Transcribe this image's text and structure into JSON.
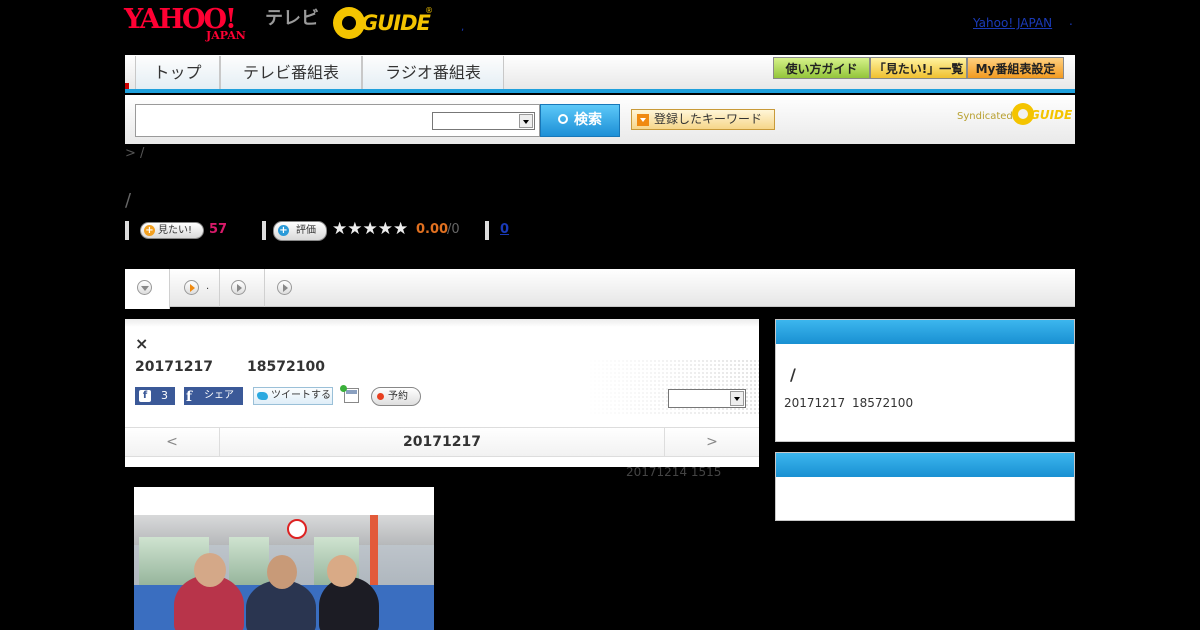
{
  "header": {
    "yahoo_logo": "YAHOO!",
    "yahoo_logo_sub": "JAPAN",
    "tv_label": "テレビ",
    "gguide_logo": "GUIDE",
    "gguide_reg": "®",
    "yahoo_japan_link": "Yahoo! JAPAN",
    "dot_right": ".",
    "dot_mid": ","
  },
  "nav": {
    "tabs": [
      {
        "label": "トップ"
      },
      {
        "label": "テレビ番組表"
      },
      {
        "label": "ラジオ番組表"
      }
    ],
    "buttons": [
      {
        "label": "使い方ガイド"
      },
      {
        "label": "「見たい!」一覧"
      },
      {
        "label": "My番組表設定"
      }
    ]
  },
  "search": {
    "input_value": "",
    "select_value": "",
    "button_label": "検索",
    "keyword_button_label": "登録したキーワード",
    "syndicated_label": "Syndicated",
    "syndicated_logo": "GUIDE"
  },
  "breadcrumb": "> /",
  "page_title": "/",
  "rating": {
    "mitai_label": "見たい!",
    "mitai_count": "57",
    "hyoka_label": "評価",
    "stars": "★★★★★",
    "score": "0.00",
    "score_denominator": "/0",
    "review_count": "0"
  },
  "subtabs": {
    "tab2_text": "."
  },
  "program": {
    "mark": "×",
    "date": "20171217",
    "time": "18572100",
    "like_count": "3",
    "share_label": "シェア",
    "tweet_label": "ツイートする",
    "reserve_label": "予約",
    "select_value": "",
    "date_nav": {
      "prev": "<",
      "date": "20171217",
      "next": ">"
    },
    "updated": "20171214  1515"
  },
  "right_panel": {
    "title": "/",
    "date": "20171217",
    "time": "18572100"
  },
  "colors": {
    "accent_blue": "#1fa0dc",
    "yahoo_red": "#ff0033",
    "gguide_yellow": "#f4c400",
    "mitai_pink": "#d81a6a",
    "score_orange": "#e07020",
    "link_blue": "#1a3ab8"
  },
  "icons": [
    "search-icon",
    "plus-icon",
    "star-icon",
    "play-circle-icon",
    "dropdown-circle-icon",
    "facebook-icon",
    "twitter-icon",
    "calendar-add-icon",
    "record-icon"
  ]
}
